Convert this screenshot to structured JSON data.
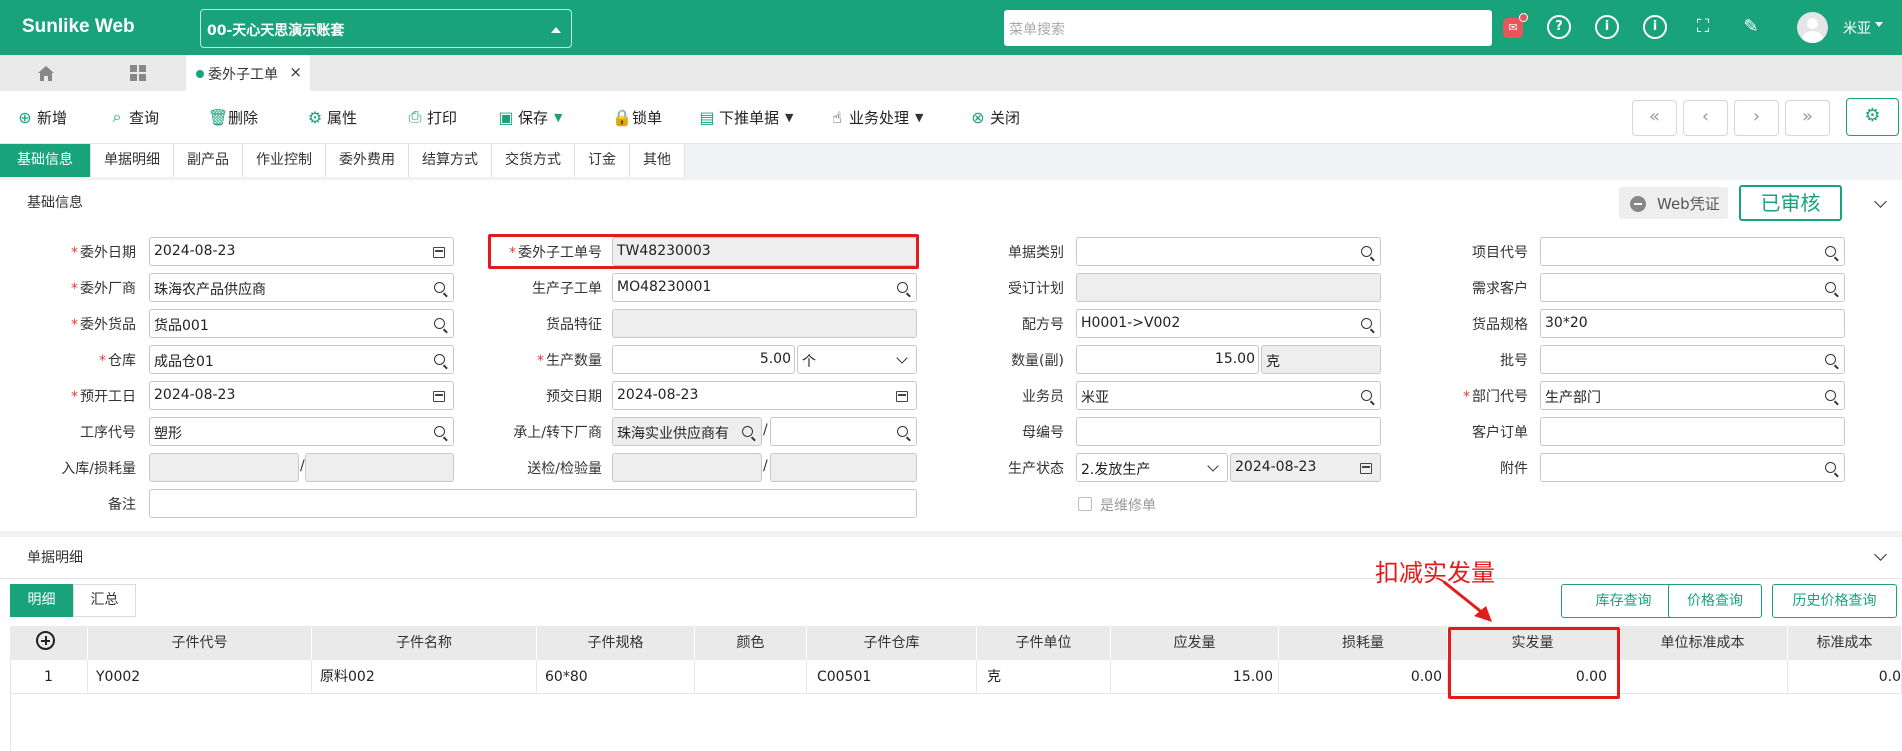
{
  "header": {
    "logo": "Sunlike Web",
    "account": "00-天心天思演示账套",
    "search_placeholder": "菜单搜索",
    "user": "米亚",
    "icons": [
      "bell-icon",
      "help-icon",
      "info-icon",
      "info-icon",
      "fullscreen-icon",
      "broom-icon"
    ]
  },
  "tabs": {
    "page_tab": "委外子工单",
    "close": "×"
  },
  "toolbar": {
    "buttons": [
      {
        "label": "新增",
        "icon": "plus-circle-icon"
      },
      {
        "label": "查询",
        "icon": "search-icon"
      },
      {
        "label": "删除",
        "icon": "trash-icon"
      },
      {
        "label": "属性",
        "icon": "gear-icon"
      },
      {
        "label": "打印",
        "icon": "printer-icon"
      },
      {
        "label": "保存",
        "icon": "save-icon",
        "dropdown": true
      },
      {
        "label": "锁单",
        "icon": "lock-icon"
      },
      {
        "label": "下推单据",
        "icon": "document-icon",
        "dropdown": true
      },
      {
        "label": "业务处理",
        "icon": "hand-icon",
        "dropdown": true
      },
      {
        "label": "关闭",
        "icon": "close-circle-icon"
      }
    ]
  },
  "form_tabs": [
    "基础信息",
    "单据明细",
    "副产品",
    "作业控制",
    "委外费用",
    "结算方式",
    "交货方式",
    "订金",
    "其他"
  ],
  "basic": {
    "section_title": "基础信息",
    "web_voucher": "Web凭证",
    "status": "已审核",
    "fields": {
      "委外日期": "2024-08-23",
      "委外子工单号": "TW48230003",
      "单据类别": "",
      "项目代号": "",
      "委外厂商": "珠海农产品供应商",
      "生产子工单": "MO48230001",
      "受订计划": "",
      "需求客户": "",
      "委外货品": "货品001",
      "货品特征": "",
      "配方号": "H0001->V002",
      "货品规格": "30*20",
      "仓库": "成品仓01",
      "生产数量": "5.00",
      "生产数量单位": "个",
      "数量(副)": "15.00",
      "数量(副)单位": "克",
      "批号": "",
      "预开工日": "2024-08-23",
      "预交日期": "2024-08-23",
      "业务员": "米亚",
      "部门代号": "生产部门",
      "工序代号": "塑形",
      "承上/转下厂商": "珠海实业供应商有",
      "母编号": "",
      "客户订单": "",
      "入库/损耗量": "",
      "送检/检验量": "",
      "生产状态": "2.发放生产",
      "生产状态日期": "2024-08-23",
      "附件": "",
      "备注": "",
      "是维修单": "是维修单"
    },
    "labels": {
      "l1": "委外日期",
      "l2": "委外子工单号",
      "l3": "单据类别",
      "l4": "项目代号",
      "l5": "委外厂商",
      "l6": "生产子工单",
      "l7": "受订计划",
      "l8": "需求客户",
      "l9": "委外货品",
      "l10": "货品特征",
      "l11": "配方号",
      "l12": "货品规格",
      "l13": "仓库",
      "l14": "生产数量",
      "l15": "数量(副)",
      "l16": "批号",
      "l17": "预开工日",
      "l18": "预交日期",
      "l19": "业务员",
      "l20": "部门代号",
      "l21": "工序代号",
      "l22": "承上/转下厂商",
      "l23": "母编号",
      "l24": "客户订单",
      "l25": "入库/损耗量",
      "l26": "送检/检验量",
      "l27": "生产状态",
      "l28": "附件",
      "l29": "备注"
    }
  },
  "detail": {
    "section_title": "单据明细",
    "subtabs": [
      "明细",
      "汇总"
    ],
    "buttons": [
      "库存查询",
      "价格查询",
      "历史价格查询"
    ],
    "annotation": "扣减实发量",
    "columns": [
      "子件代号",
      "子件名称",
      "子件规格",
      "颜色",
      "子件仓库",
      "子件单位",
      "应发量",
      "损耗量",
      "实发量",
      "单位标准成本",
      "标准成本"
    ],
    "rows": [
      [
        "1",
        "Y0002",
        "原料002",
        "60*80",
        "",
        "C00501",
        "克",
        "15.00",
        "0.00",
        "0.00",
        "",
        "0.0"
      ]
    ]
  },
  "colors": {
    "brand": "#18a37a",
    "annotation": "#e31b1b",
    "required": "#e23c3c"
  }
}
